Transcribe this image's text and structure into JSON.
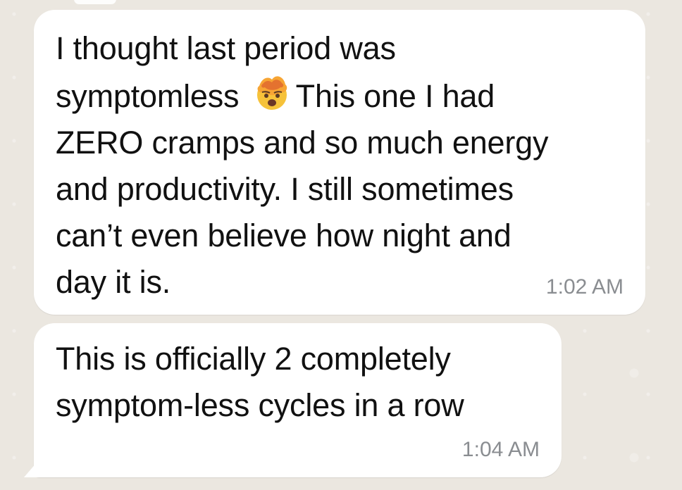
{
  "chat": {
    "messages": [
      {
        "text_before_emoji": "I thought last period was\nsymptomless",
        "emoji_icon": "exploding-head-emoji",
        "text_after_emoji": "This one I had\nZERO cramps and so much energy\nand productivity. I still sometimes\ncan’t even believe how night and\nday it is.",
        "time": "1:02 AM"
      },
      {
        "text": "This is officially 2 completely\nsymptom-less cycles in a row",
        "time": "1:04 AM"
      }
    ]
  }
}
